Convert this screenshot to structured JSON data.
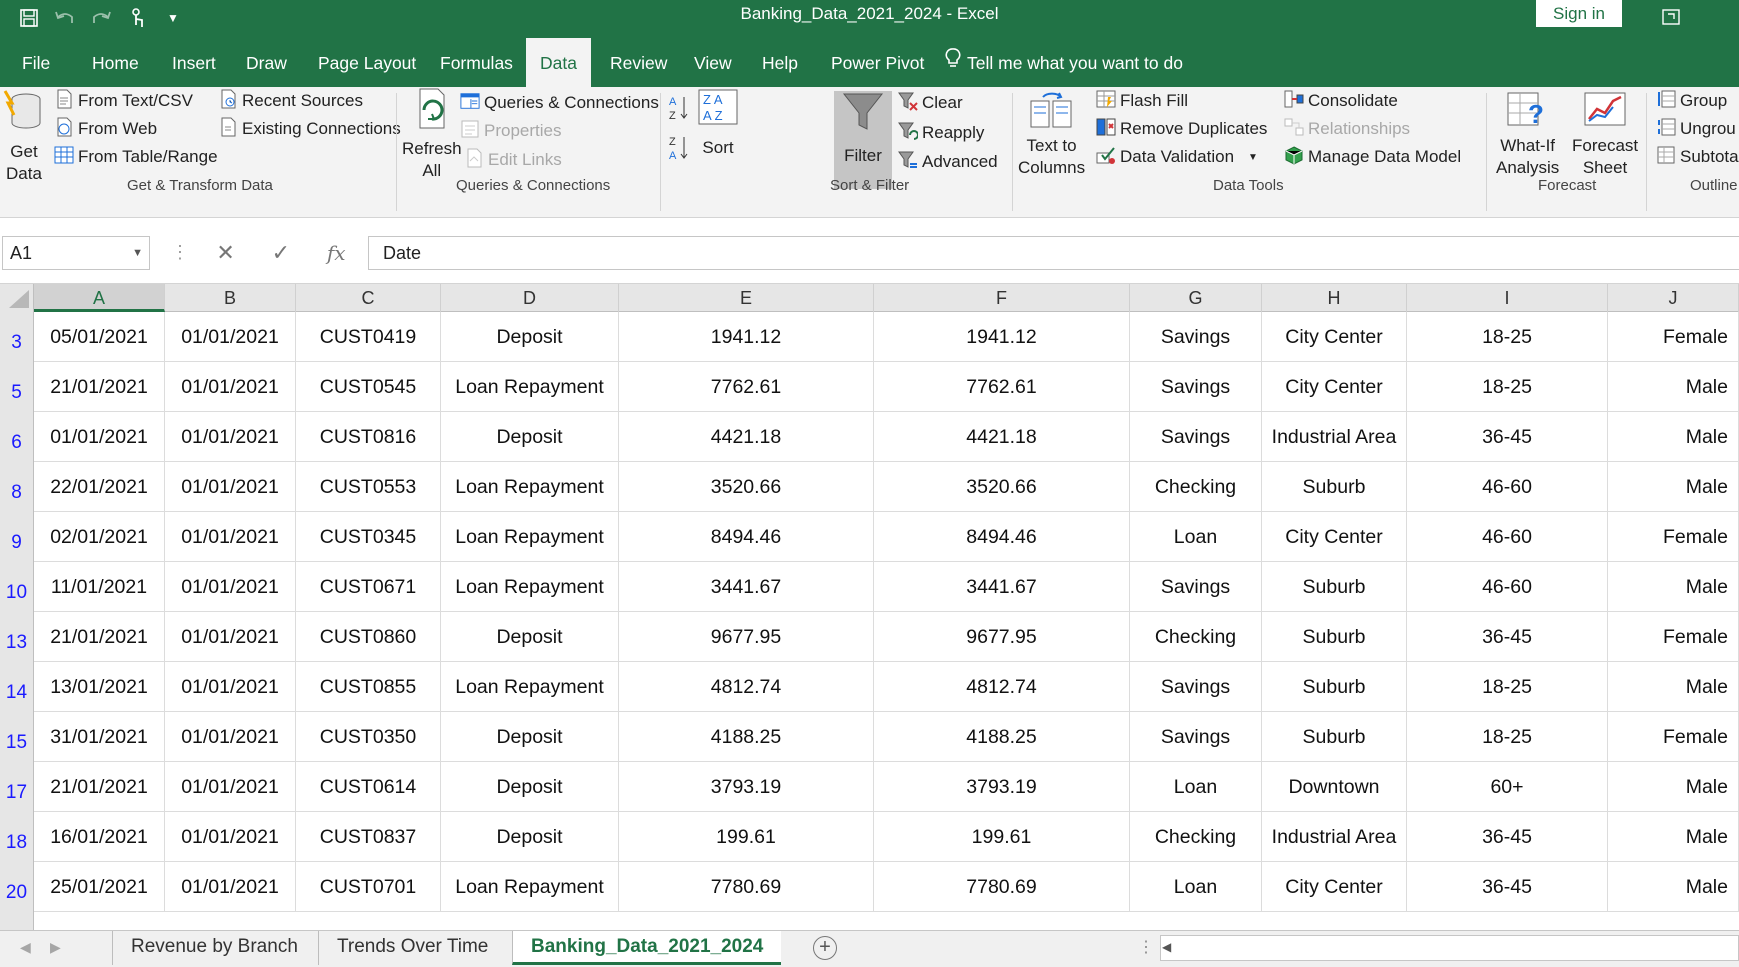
{
  "window": {
    "title": "Banking_Data_2021_2024  -  Excel",
    "signin_label": "Sign in",
    "restore_icon": "restore-window-icon"
  },
  "tabs": [
    "File",
    "Home",
    "Insert",
    "Draw",
    "Page Layout",
    "Formulas",
    "Data",
    "Review",
    "View",
    "Help",
    "Power Pivot"
  ],
  "active_tab": "Data",
  "tell_me": "Tell me what you want to do",
  "ribbon": {
    "get_transform": {
      "get_data_1": "Get",
      "get_data_2": "Data",
      "from_text_csv": "From Text/CSV",
      "from_web": "From Web",
      "from_table_range": "From Table/Range",
      "recent_sources": "Recent Sources",
      "existing_connections": "Existing Connections",
      "group_label": "Get & Transform Data"
    },
    "queries": {
      "refresh_1": "Refresh",
      "refresh_2": "All",
      "queries_connections": "Queries & Connections",
      "properties": "Properties",
      "edit_links": "Edit Links",
      "group_label": "Queries & Connections"
    },
    "sort_filter": {
      "sort": "Sort",
      "filter": "Filter",
      "clear": "Clear",
      "reapply": "Reapply",
      "advanced": "Advanced",
      "group_label": "Sort & Filter"
    },
    "data_tools": {
      "text_to_columns_1": "Text to",
      "text_to_columns_2": "Columns",
      "flash_fill": "Flash Fill",
      "remove_duplicates": "Remove Duplicates",
      "data_validation": "Data Validation",
      "consolidate": "Consolidate",
      "relationships": "Relationships",
      "manage_data_model": "Manage Data Model",
      "group_label": "Data Tools"
    },
    "forecast": {
      "what_if_1": "What-If",
      "what_if_2": "Analysis",
      "forecast_sheet_1": "Forecast",
      "forecast_sheet_2": "Sheet",
      "group_label": "Forecast"
    },
    "outline": {
      "group": "Group",
      "ungroup": "Ungrou",
      "subtotal": "Subtota",
      "group_label": "Outline"
    }
  },
  "formula_bar": {
    "name_box": "A1",
    "formula": "Date"
  },
  "columns": [
    "A",
    "B",
    "C",
    "D",
    "E",
    "F",
    "G",
    "H",
    "I",
    "J"
  ],
  "rows": [
    {
      "num": "3",
      "cells": [
        "05/01/2021",
        "01/01/2021",
        "CUST0419",
        "Deposit",
        "1941.12",
        "1941.12",
        "Savings",
        "City Center",
        "18-25",
        "Female"
      ]
    },
    {
      "num": "5",
      "cells": [
        "21/01/2021",
        "01/01/2021",
        "CUST0545",
        "Loan Repayment",
        "7762.61",
        "7762.61",
        "Savings",
        "City Center",
        "18-25",
        "Male"
      ]
    },
    {
      "num": "6",
      "cells": [
        "01/01/2021",
        "01/01/2021",
        "CUST0816",
        "Deposit",
        "4421.18",
        "4421.18",
        "Savings",
        "Industrial Area",
        "36-45",
        "Male"
      ]
    },
    {
      "num": "8",
      "cells": [
        "22/01/2021",
        "01/01/2021",
        "CUST0553",
        "Loan Repayment",
        "3520.66",
        "3520.66",
        "Checking",
        "Suburb",
        "46-60",
        "Male"
      ]
    },
    {
      "num": "9",
      "cells": [
        "02/01/2021",
        "01/01/2021",
        "CUST0345",
        "Loan Repayment",
        "8494.46",
        "8494.46",
        "Loan",
        "City Center",
        "46-60",
        "Female"
      ]
    },
    {
      "num": "10",
      "cells": [
        "11/01/2021",
        "01/01/2021",
        "CUST0671",
        "Loan Repayment",
        "3441.67",
        "3441.67",
        "Savings",
        "Suburb",
        "46-60",
        "Male"
      ]
    },
    {
      "num": "13",
      "cells": [
        "21/01/2021",
        "01/01/2021",
        "CUST0860",
        "Deposit",
        "9677.95",
        "9677.95",
        "Checking",
        "Suburb",
        "36-45",
        "Female"
      ]
    },
    {
      "num": "14",
      "cells": [
        "13/01/2021",
        "01/01/2021",
        "CUST0855",
        "Loan Repayment",
        "4812.74",
        "4812.74",
        "Savings",
        "Suburb",
        "18-25",
        "Male"
      ]
    },
    {
      "num": "15",
      "cells": [
        "31/01/2021",
        "01/01/2021",
        "CUST0350",
        "Deposit",
        "4188.25",
        "4188.25",
        "Savings",
        "Suburb",
        "18-25",
        "Female"
      ]
    },
    {
      "num": "17",
      "cells": [
        "21/01/2021",
        "01/01/2021",
        "CUST0614",
        "Deposit",
        "3793.19",
        "3793.19",
        "Loan",
        "Downtown",
        "60+",
        "Male"
      ]
    },
    {
      "num": "18",
      "cells": [
        "16/01/2021",
        "01/01/2021",
        "CUST0837",
        "Deposit",
        "199.61",
        "199.61",
        "Checking",
        "Industrial Area",
        "36-45",
        "Male"
      ]
    },
    {
      "num": "20",
      "cells": [
        "25/01/2021",
        "01/01/2021",
        "CUST0701",
        "Loan Repayment",
        "7780.69",
        "7780.69",
        "Loan",
        "City Center",
        "36-45",
        "Male"
      ]
    }
  ],
  "sheets": [
    "Revenue by Branch",
    "Trends Over Time",
    "Banking_Data_2021_2024"
  ],
  "active_sheet": "Banking_Data_2021_2024",
  "colors": {
    "accent": "#217346",
    "row_number": "#1a1aff"
  }
}
